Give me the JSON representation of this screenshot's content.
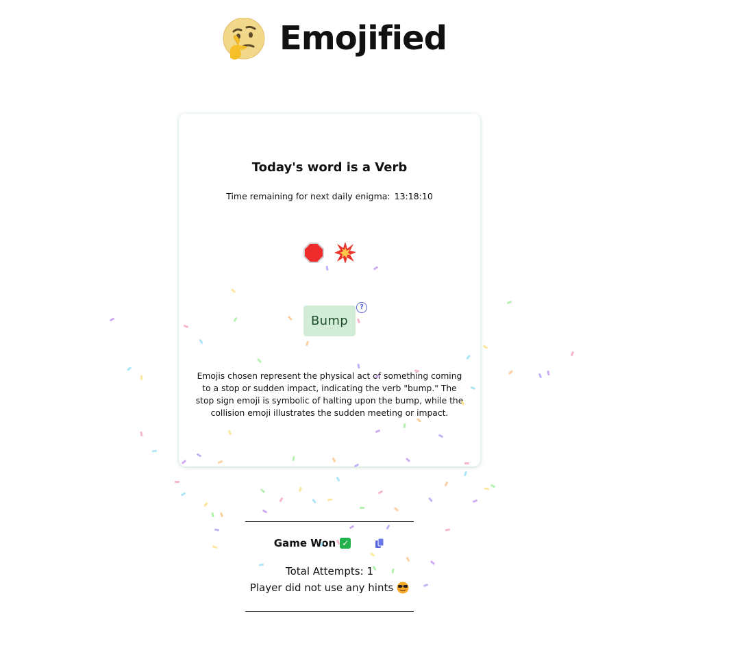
{
  "app": {
    "title": "Emojified",
    "logo_icon": "thinking-face-icon"
  },
  "puzzle": {
    "word_type_label": "Today's word is a Verb",
    "timer_label": "Time remaining for next daily enigma:",
    "timer_value": "13:18:10",
    "emojis": [
      "stop-sign-icon",
      "collision-icon"
    ],
    "answer": "Bump",
    "help_icon": "question-circle-icon",
    "explanation": "Emojis chosen represent the physical act of something coming to a stop or sudden impact, indicating the verb \"bump.\" The stop sign emoji is symbolic of halting upon the bump, while the collision emoji illustrates the sudden meeting or impact."
  },
  "result": {
    "status": "Game Won",
    "status_icon": "check-mark-icon",
    "copy_icon": "copy-icon",
    "attempts_text": "Total Attempts: 1",
    "hints_text": "Player did not use any hints",
    "hints_icon": "cool-face-icon"
  },
  "colors": {
    "answer_bg": "#d3ecd8",
    "answer_text": "#1d4e2a",
    "accent": "#5a67d8",
    "success": "#22b14c",
    "confetti": [
      "#c79bf2",
      "#f7a8c8",
      "#9fe0f7",
      "#fbe38a",
      "#a7eea1",
      "#fdc58e",
      "#b9a4f7"
    ]
  }
}
